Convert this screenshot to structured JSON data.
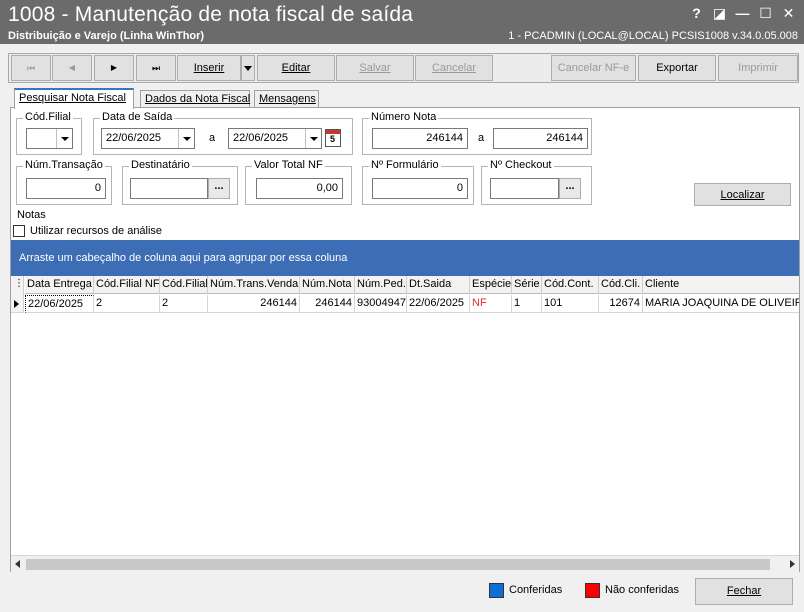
{
  "window": {
    "title": "1008 - Manutenção de nota fiscal de saída",
    "subtitle": "Distribuição e Varejo (Linha WinThor)",
    "session": "1 - PCADMIN (LOCAL@LOCAL)   PCSIS1008  v.34.0.05.008",
    "help": "?",
    "restore": "◪",
    "minimize": "—",
    "maximize": "☐",
    "close": "✕"
  },
  "toolbar": {
    "first": "⏮",
    "prev": "◀",
    "next": "▶",
    "last": "⏭",
    "inserir": "Inserir",
    "editar": "Editar",
    "salvar": "Salvar",
    "cancelar": "Cancelar",
    "cancelar_nfe": "Cancelar NF-e",
    "exportar": "Exportar",
    "imprimir": "Imprimir"
  },
  "tabs": [
    {
      "label": "Pesquisar Nota Fiscal"
    },
    {
      "label": "Dados da Nota Fiscal"
    },
    {
      "label": "Mensagens"
    }
  ],
  "filters": {
    "cod_filial": {
      "label": "Cód.Filial",
      "value": ""
    },
    "data_saida": {
      "label": "Data de Saída",
      "from": "22/06/2025",
      "sep": "a",
      "to": "22/06/2025",
      "cal_day": "5"
    },
    "numero_nota": {
      "label": "Número Nota",
      "from": "246144",
      "sep": "a",
      "to": "246144"
    },
    "num_transacao": {
      "label": "Núm.Transação",
      "value": "0"
    },
    "destinatario": {
      "label": "Destinatário",
      "value": "",
      "btn": "..."
    },
    "valor_total": {
      "label": "Valor Total NF",
      "value": "0,00"
    },
    "num_formulario": {
      "label": "Nº Formulário",
      "value": "0"
    },
    "num_checkout": {
      "label": "Nº Checkout",
      "value": "",
      "btn": "..."
    },
    "localizar": "Localizar"
  },
  "notas": {
    "label": "Notas",
    "checkbox_label": "Utilizar recursos de análise",
    "group_hint": "Arraste um cabeçalho de coluna aqui para agrupar por essa coluna"
  },
  "grid": {
    "columns": [
      "Data Entrega",
      "Cód.Filial NF",
      "Cód.Filial",
      "Núm.Trans.Venda",
      "Núm.Nota",
      "Núm.Ped.",
      "Dt.Saida",
      "Espécie",
      "Série",
      "Cód.Cont.",
      "Cód.Cli.",
      "Cliente"
    ],
    "rows": [
      [
        "22/06/2025",
        "2",
        "2",
        "246144",
        "246144",
        "93004947",
        "22/06/2025",
        "NF",
        "1",
        "101",
        "12674",
        "MARIA JOAQUINA DE OLIVEIRA"
      ]
    ]
  },
  "footer": {
    "conferidas": "Conferidas",
    "nao_conferidas": "Não conferidas",
    "fechar": "Fechar",
    "color_conferidas": "#0a6fd6",
    "color_nao_conferidas": "#ff0000"
  }
}
